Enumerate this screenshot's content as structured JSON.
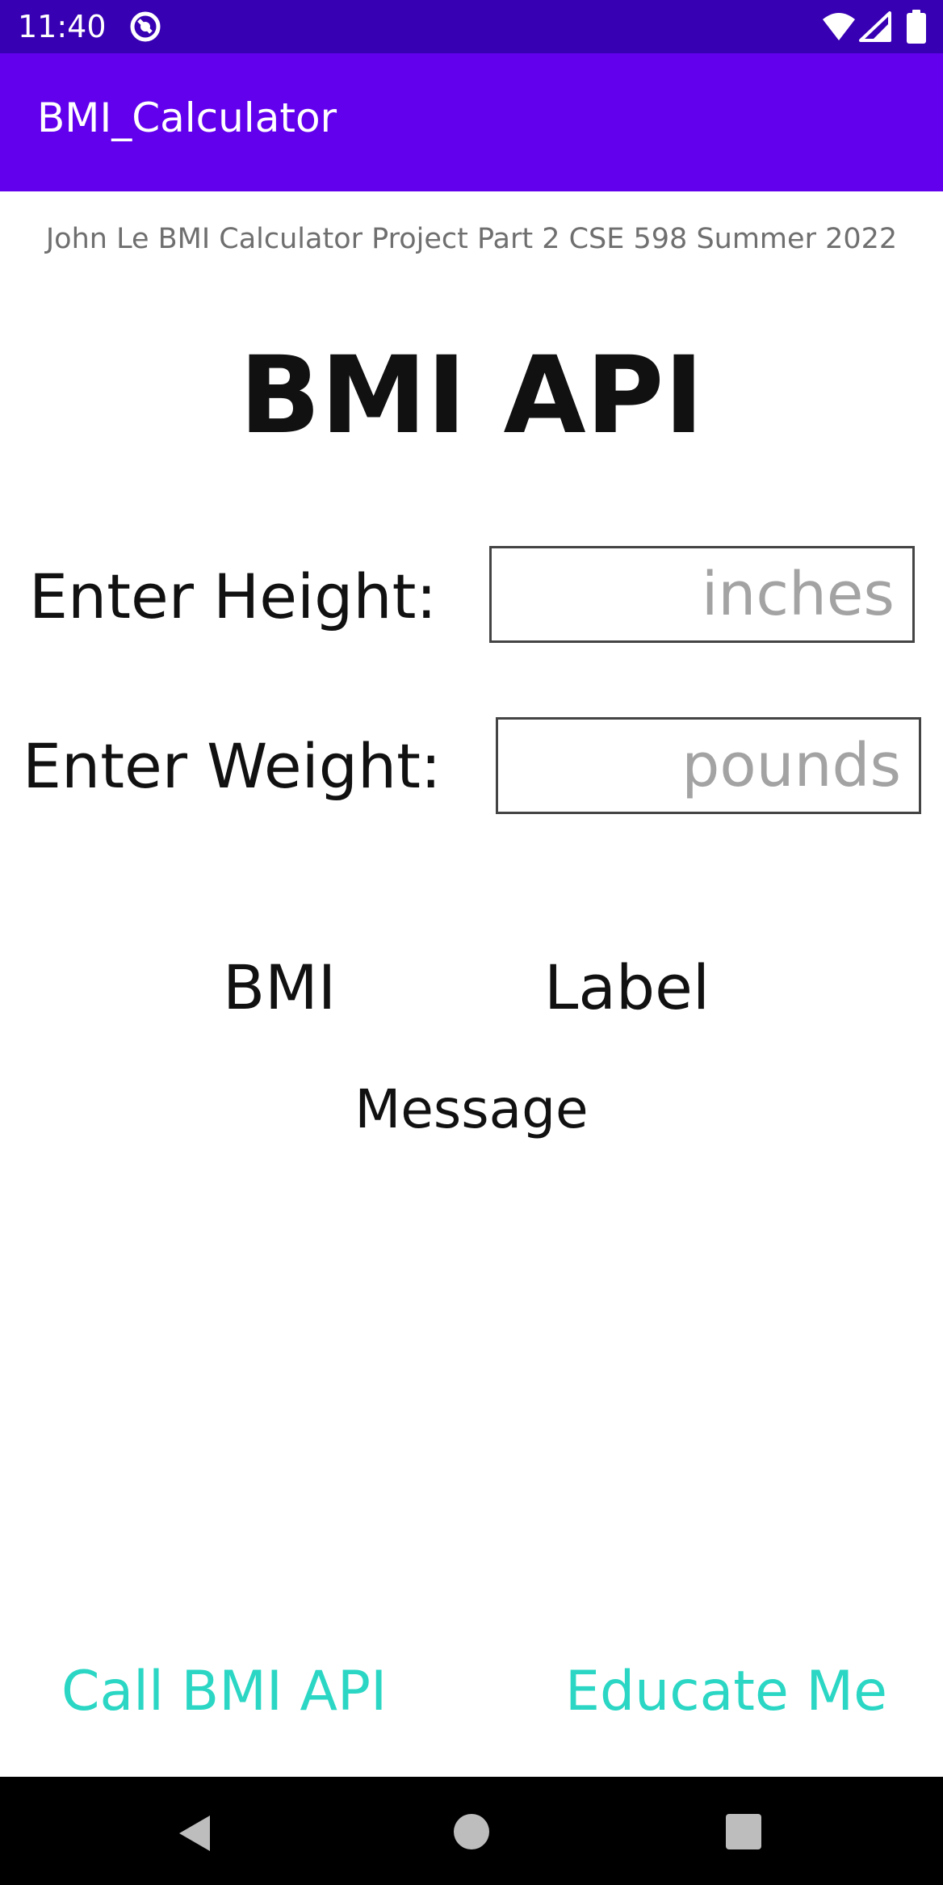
{
  "status_bar": {
    "time": "11:40",
    "icons": [
      "app-notification-icon",
      "wifi-icon",
      "signal-icon",
      "battery-icon"
    ],
    "color": "#3700b3"
  },
  "app_bar": {
    "title": "BMI_Calculator",
    "color": "#6200ee"
  },
  "content": {
    "subtitle": "John Le BMI Calculator Project Part 2 CSE 598 Summer 2022",
    "heading": "BMI API",
    "height": {
      "label": "Enter Height:",
      "value": "",
      "placeholder": "inches"
    },
    "weight": {
      "label": "Enter Weight:",
      "value": "",
      "placeholder": "pounds"
    },
    "result": {
      "bmi": "BMI",
      "label": "Label",
      "message": "Message"
    }
  },
  "actions": {
    "call_api": "Call BMI API",
    "educate": "Educate Me",
    "color": "#2bd7c4"
  },
  "nav_bar": {
    "icons": [
      "back-icon",
      "home-icon",
      "recents-icon"
    ]
  }
}
